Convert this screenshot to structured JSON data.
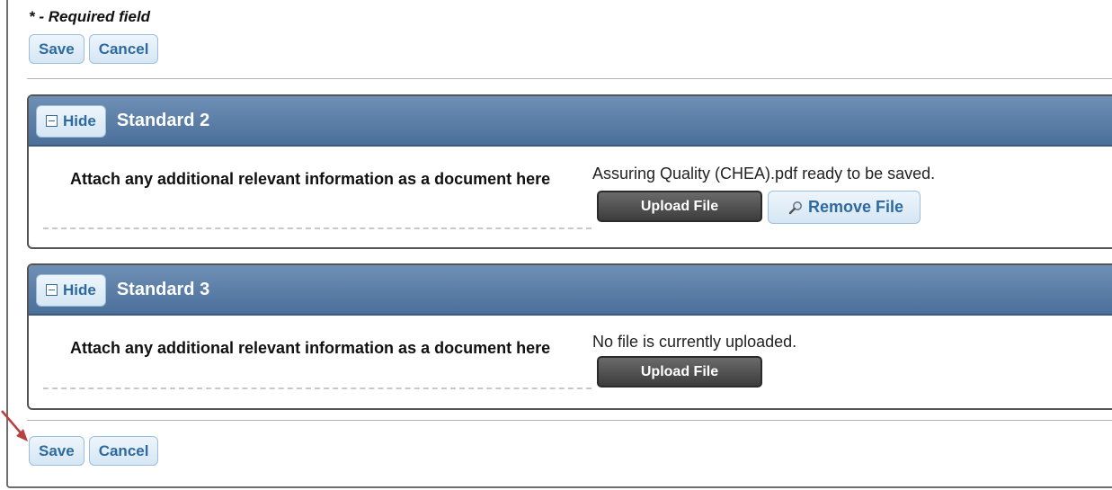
{
  "form": {
    "required_note": "* - Required field",
    "save_label": "Save",
    "cancel_label": "Cancel"
  },
  "panels": [
    {
      "hide_label": "Hide",
      "title": "Standard 2",
      "field_label": "Attach any additional relevant information as a document here",
      "file_status": "Assuring Quality (CHEA).pdf ready to be saved.",
      "upload_label": "Upload File",
      "remove_label": "Remove File"
    },
    {
      "hide_label": "Hide",
      "title": "Standard 3",
      "field_label": "Attach any additional relevant information as a document here",
      "file_status": "No file is currently uploaded.",
      "upload_label": "Upload File"
    }
  ],
  "icons": {
    "collapse": "minus-box-icon",
    "remove": "magnifier-icon",
    "annotation": "arrow-icon"
  },
  "colors": {
    "header_blue": "#4a6f99",
    "button_text": "#2d6a9f",
    "arrow": "#b84040"
  }
}
